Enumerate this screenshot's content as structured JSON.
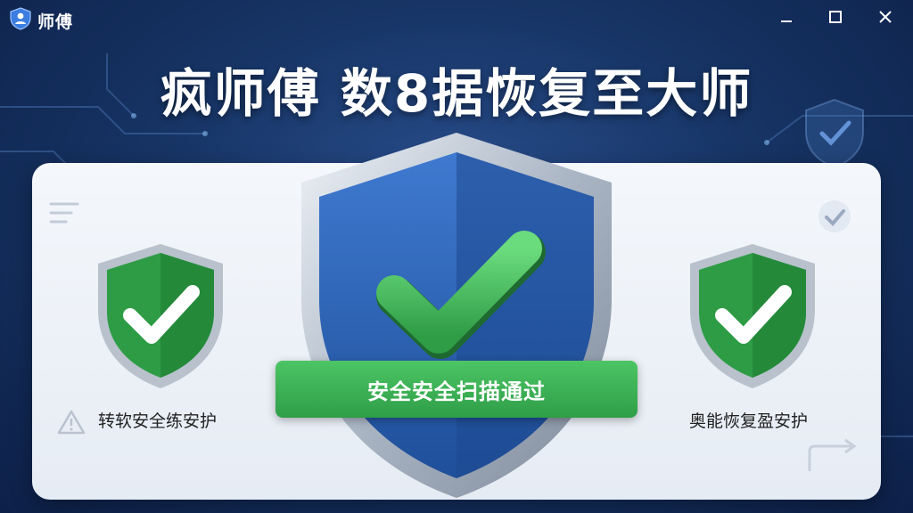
{
  "app": {
    "name": "师傅",
    "headline": "疯师傅 数8据恢复至大师"
  },
  "status": {
    "scan_badge": "安全安全扫描通过"
  },
  "shields": {
    "left_label": "转软安全练安护",
    "right_label": "奥能恢复盈安护"
  },
  "icons": {
    "logo": "shield-person-icon",
    "minimize": "minimize-icon",
    "maximize": "maximize-icon",
    "close": "close-icon",
    "menu": "menu-lines-icon",
    "warning": "warning-icon",
    "check": "check-icon"
  },
  "colors": {
    "background": "#173566",
    "shield_blue": "#2f66b8",
    "shield_green": "#2e9c45",
    "badge_green": "#3bb155"
  }
}
